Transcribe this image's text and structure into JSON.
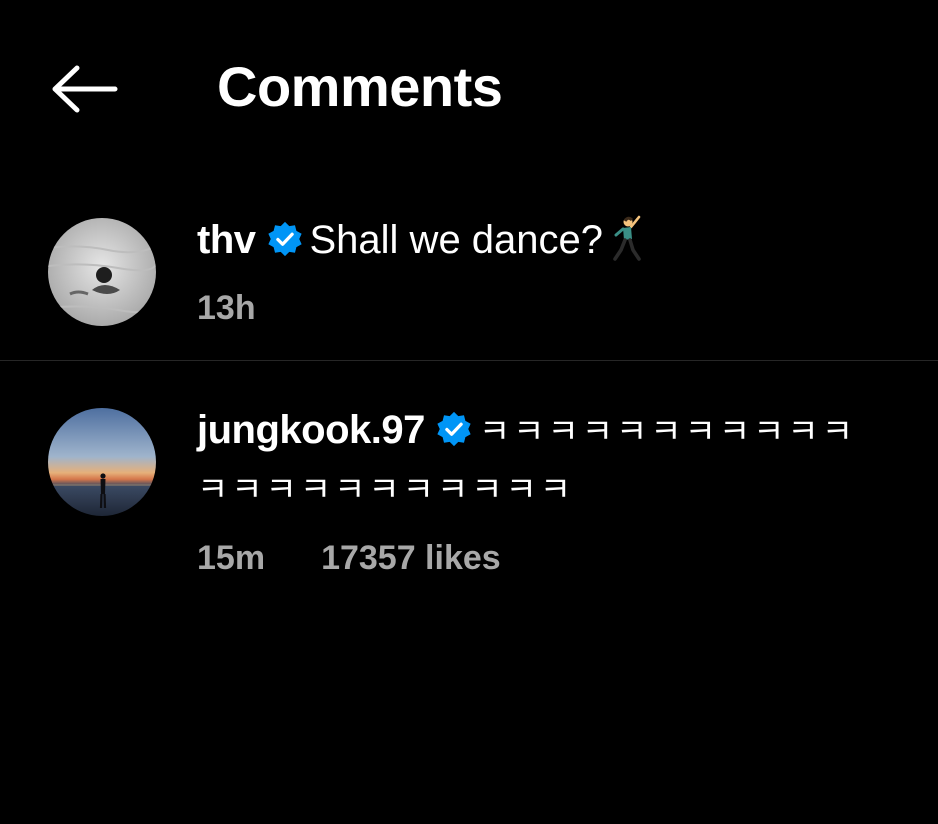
{
  "header": {
    "title": "Comments",
    "back_icon": "arrow-left-icon"
  },
  "colors": {
    "background": "#000000",
    "text": "#ffffff",
    "muted": "#a8a8a8",
    "verified": "#0095f6",
    "divider": "#262626"
  },
  "comments": [
    {
      "username": "thv",
      "verified": true,
      "text": "Shall we dance?",
      "emoji": "man-dancing-icon",
      "time": "13h",
      "likes": ""
    },
    {
      "username": "jungkook.97",
      "verified": true,
      "text_line1": "ㅋㅋㅋㅋㅋㅋㅋㅋㅋㅋㅋ",
      "text_line2": "ㅋㅋㅋㅋㅋㅋㅋㅋㅋㅋㅋ",
      "time": "15m",
      "likes": "17357 likes"
    }
  ]
}
